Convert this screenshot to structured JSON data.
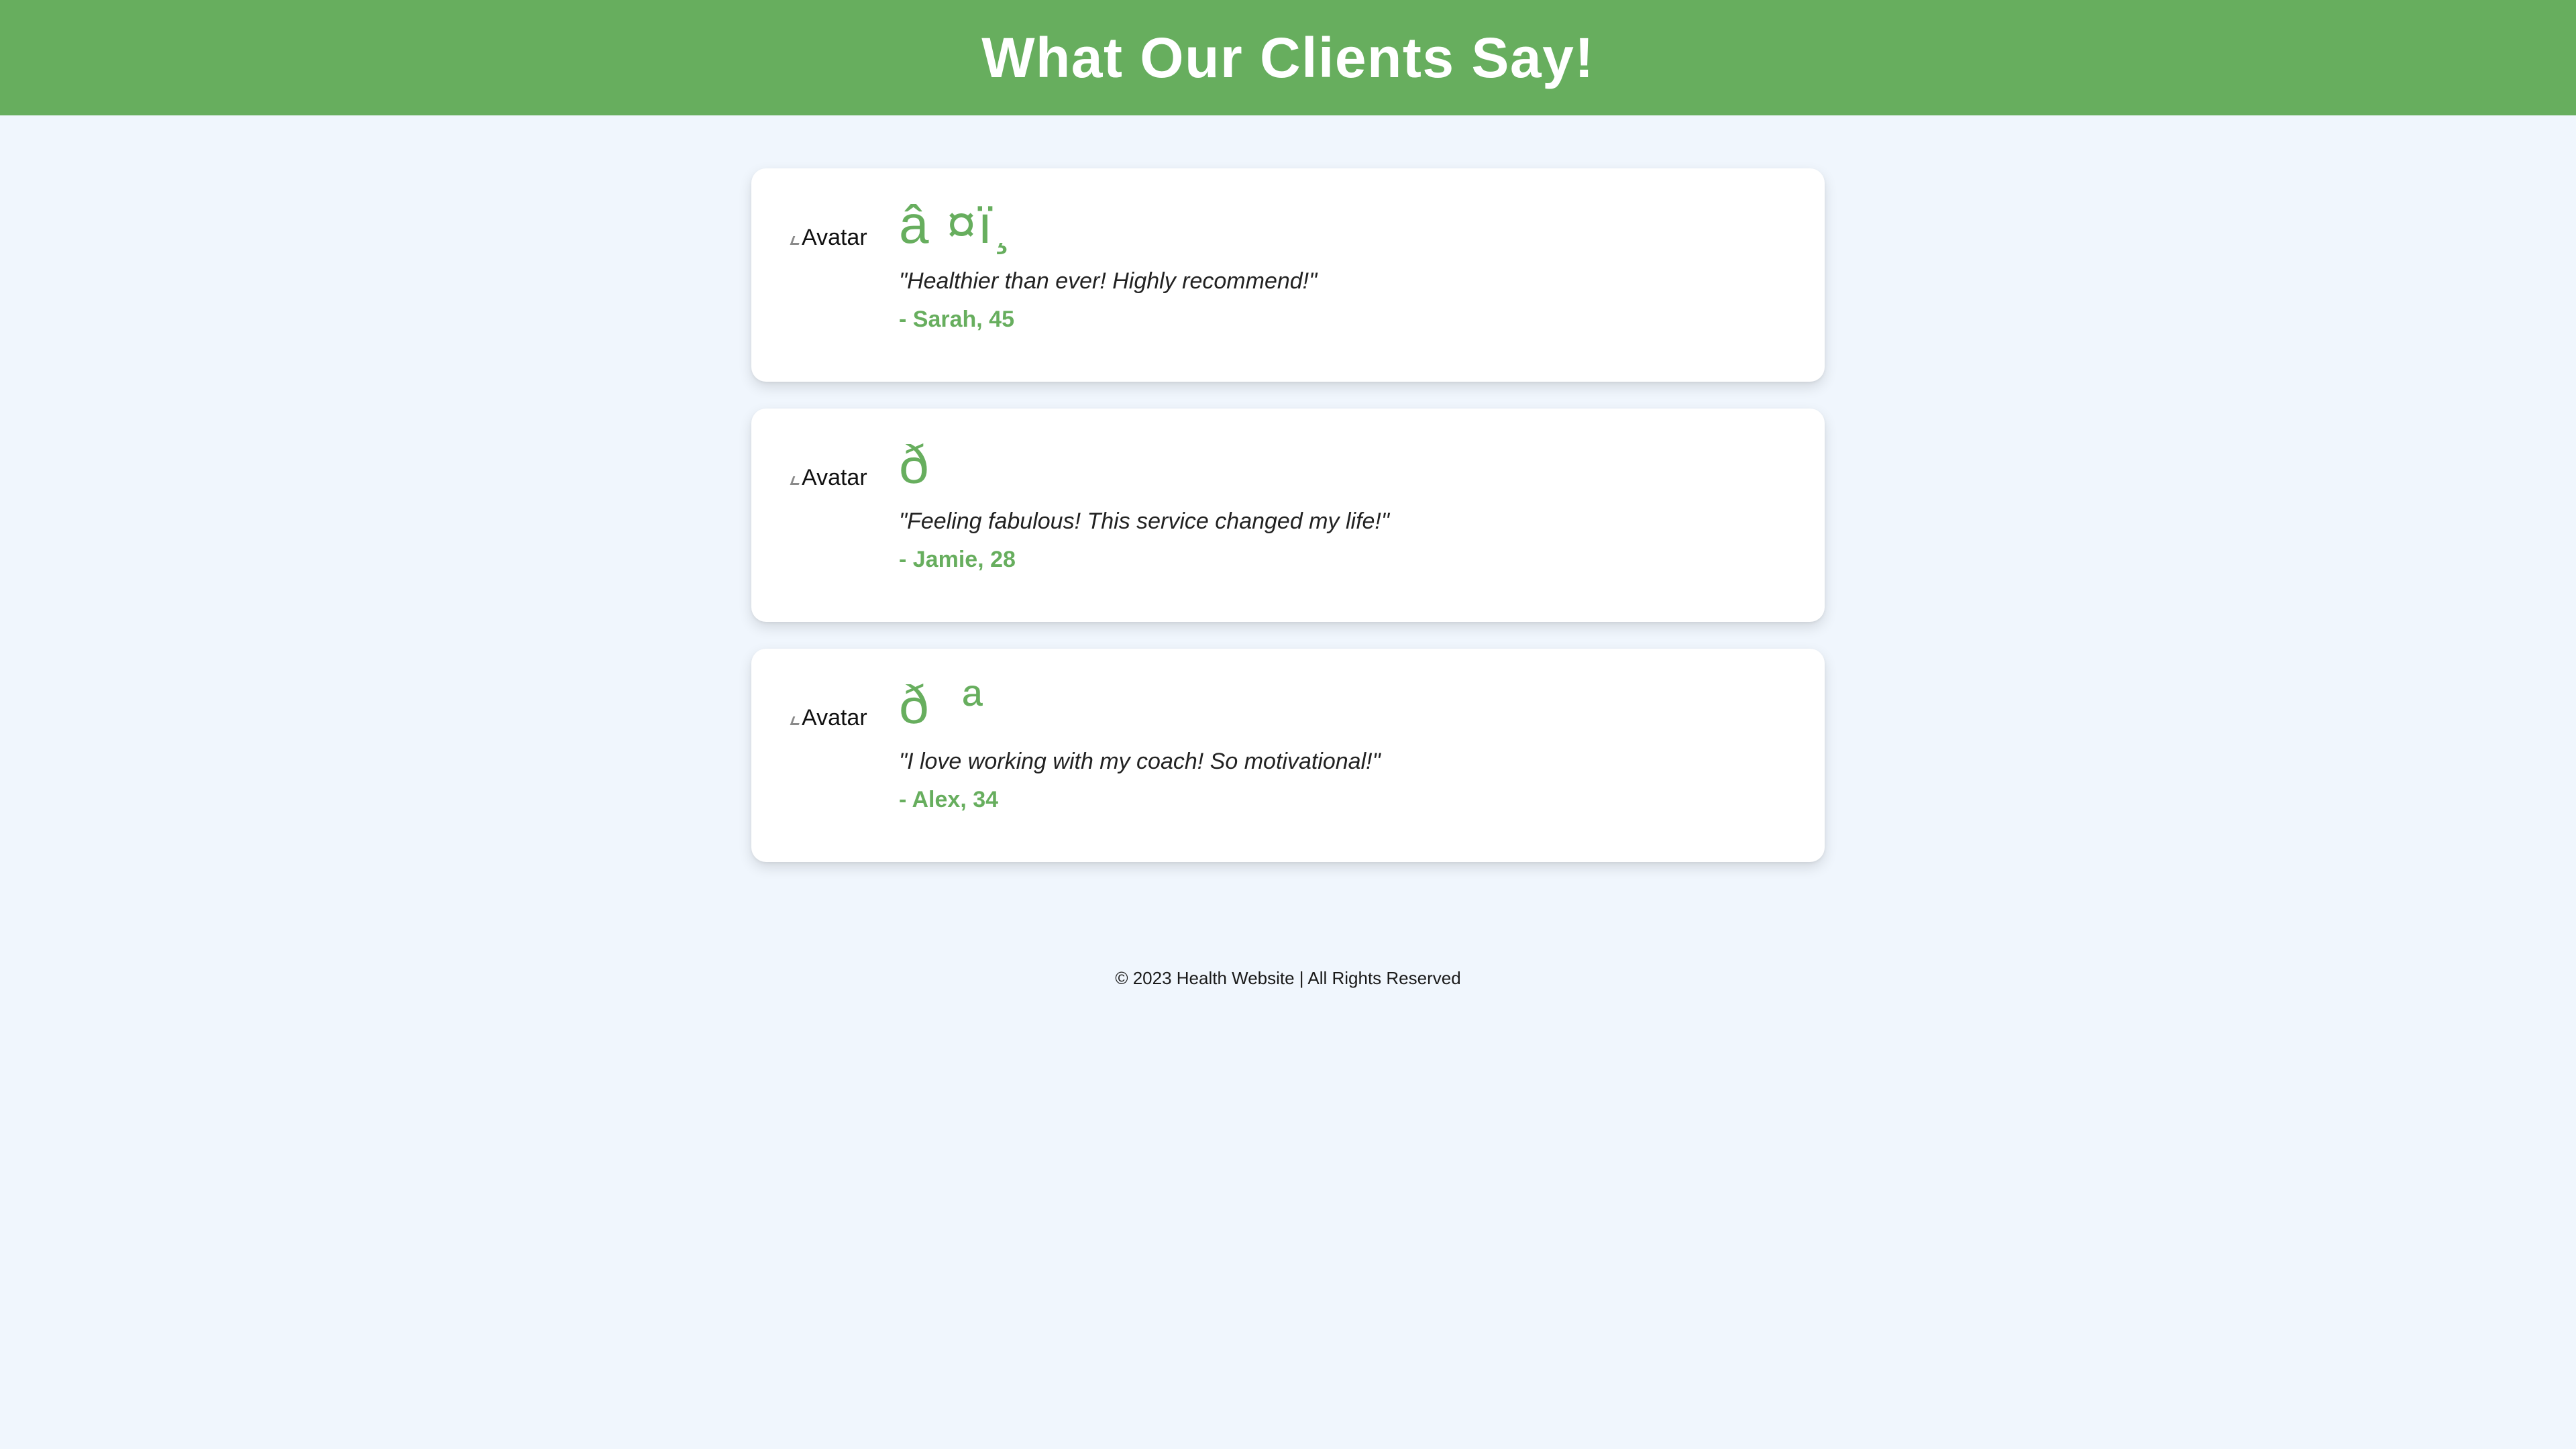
{
  "header": {
    "title": "What Our Clients Say!"
  },
  "testimonials": [
    {
      "avatar_alt": "Avatar",
      "emoji": "â ¤ï¸ ",
      "quote": "\"Healthier than ever! Highly recommend!\"",
      "author": "- Sarah, 45"
    },
    {
      "avatar_alt": "Avatar",
      "emoji": "ð   ",
      "quote": "\"Feeling fabulous! This service changed my life!\"",
      "author": "- Jamie, 28"
    },
    {
      "avatar_alt": "Avatar",
      "emoji": "ð  ª",
      "quote": "\"I love working with my coach! So motivational!\"",
      "author": "- Alex, 34"
    }
  ],
  "footer": {
    "text": "© 2023 Health Website | All Rights Reserved"
  },
  "colors": {
    "accent": "#67ae5e",
    "background": "#f0f6fd",
    "card": "#ffffff"
  }
}
